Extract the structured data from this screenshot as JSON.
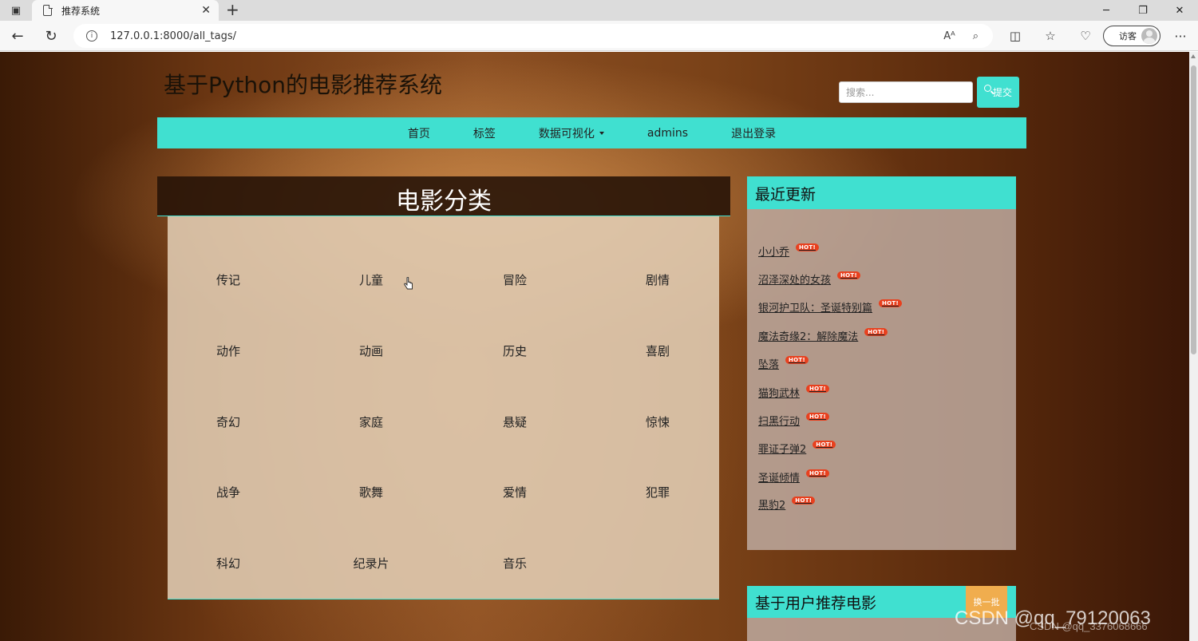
{
  "browser": {
    "tab_title": "推荐系统",
    "tab_close": "✕",
    "new_tab": "+",
    "url": "127.0.0.1:8000/all_tags/",
    "profile_label": "访客",
    "read_aloud": "Aᴬ",
    "more": "···"
  },
  "site": {
    "title": "基于Python的电影推荐系统",
    "search_placeholder": "搜索...",
    "search_button": "提交"
  },
  "nav": {
    "home": "首页",
    "tags": "标签",
    "dataviz": "数据可视化",
    "user": "admins",
    "logout": "退出登录"
  },
  "categories": {
    "heading": "电影分类",
    "items": [
      "传记",
      "儿童",
      "冒险",
      "剧情",
      "动作",
      "动画",
      "历史",
      "喜剧",
      "奇幻",
      "家庭",
      "悬疑",
      "惊悚",
      "战争",
      "歌舞",
      "爱情",
      "犯罪",
      "科幻",
      "纪录片",
      "音乐"
    ]
  },
  "recent": {
    "heading": "最近更新",
    "badge": "HOT!",
    "items": [
      "小小乔",
      "沼泽深处的女孩",
      "银河护卫队：圣诞特别篇",
      "魔法奇缘2：解除魔法",
      "坠落",
      "猫狗武林",
      "扫黑行动",
      "罪证子弹2",
      "圣诞倾情",
      "黑豹2"
    ]
  },
  "recommend": {
    "heading": "基于用户推荐电影",
    "swap_button": "换一批"
  },
  "watermark": "CSDN @qq_79120063",
  "watermark_small": "CSDN @qq_3376068666"
}
